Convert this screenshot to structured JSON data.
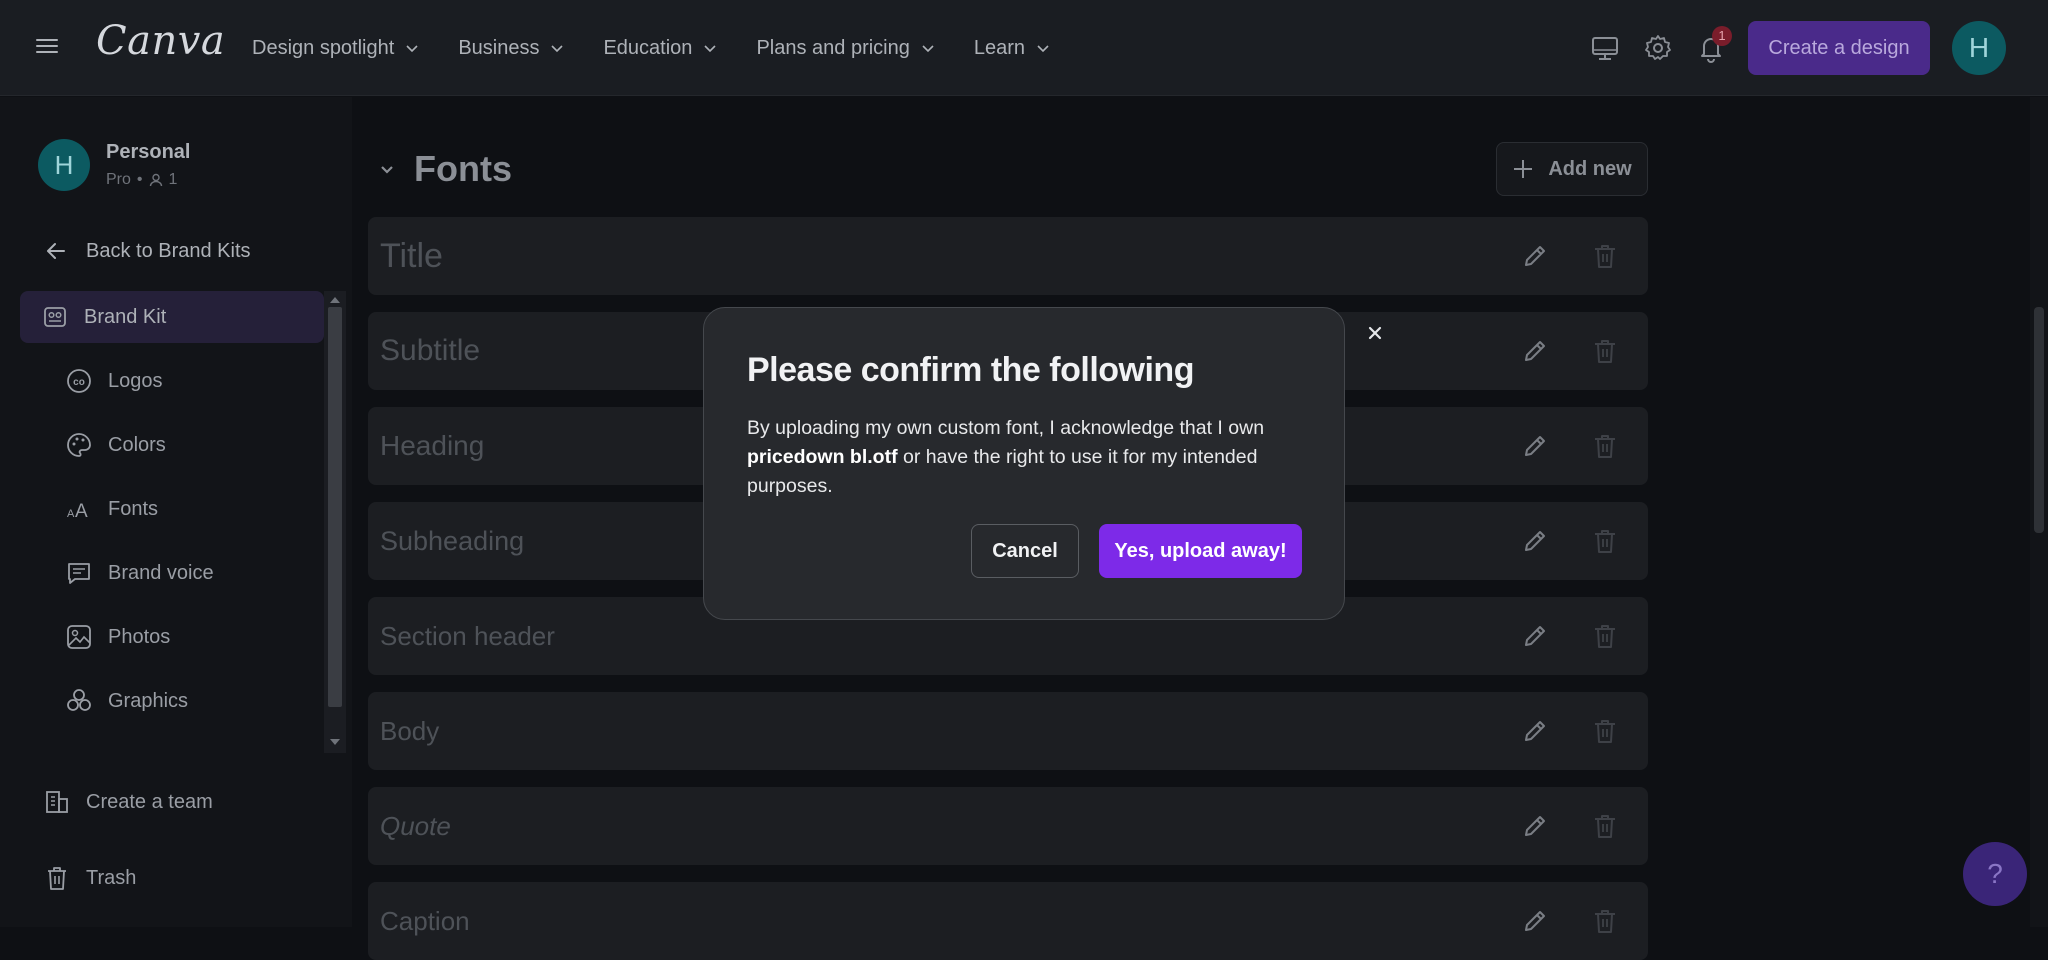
{
  "topnav": {
    "logo": "Canva",
    "items": [
      {
        "label": "Design spotlight"
      },
      {
        "label": "Business"
      },
      {
        "label": "Education"
      },
      {
        "label": "Plans and pricing"
      },
      {
        "label": "Learn"
      }
    ],
    "notification_count": "1",
    "create_label": "Create a design",
    "avatar_initial": "H"
  },
  "sidebar": {
    "profile": {
      "initial": "H",
      "name": "Personal",
      "plan": "Pro",
      "members": "1"
    },
    "back_label": "Back to Brand Kits",
    "items": [
      {
        "label": "Brand Kit",
        "icon": "brand-kit-icon",
        "active": true
      },
      {
        "label": "Logos",
        "icon": "logo-icon"
      },
      {
        "label": "Colors",
        "icon": "palette-icon"
      },
      {
        "label": "Fonts",
        "icon": "fonts-icon"
      },
      {
        "label": "Brand voice",
        "icon": "brand-voice-icon"
      },
      {
        "label": "Photos",
        "icon": "photo-icon"
      },
      {
        "label": "Graphics",
        "icon": "graphics-icon"
      }
    ],
    "create_team_label": "Create a team",
    "trash_label": "Trash"
  },
  "main": {
    "section_title": "Fonts",
    "add_new_label": "Add new",
    "fonts": [
      {
        "label": "Title"
      },
      {
        "label": "Subtitle"
      },
      {
        "label": "Heading"
      },
      {
        "label": "Subheading"
      },
      {
        "label": "Section header"
      },
      {
        "label": "Body"
      },
      {
        "label": "Quote"
      },
      {
        "label": "Caption"
      }
    ],
    "help_label": "?"
  },
  "modal": {
    "title": "Please confirm the following",
    "body_before": "By uploading my own custom font, I acknowledge that I own ",
    "file_name": "pricedown bl.otf",
    "body_after": " or have the right to use it for my intended purposes.",
    "cancel_label": "Cancel",
    "confirm_label": "Yes, upload away!"
  },
  "colors": {
    "accent": "#7d2ae8",
    "modal_bg": "#27292d",
    "page_bg": "#0e1014"
  }
}
